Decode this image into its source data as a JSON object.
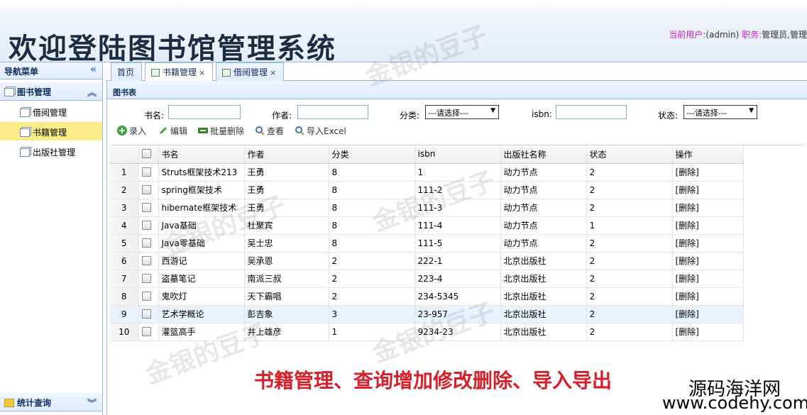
{
  "header": {
    "title": "欢迎登陆图书馆管理系统",
    "user_label": "当前用户:",
    "user_value": "(admin)",
    "role_label": "职务:",
    "role_value": "管理员,管理"
  },
  "nav": {
    "title": "导航菜单",
    "collapse_glyph": "«",
    "group1": {
      "label": "图书管理",
      "items": [
        "借阅管理",
        "书籍管理",
        "出版社管理"
      ]
    },
    "group2": {
      "label": "统计查询"
    }
  },
  "tabs": [
    {
      "label": "首页"
    },
    {
      "label": "书籍管理",
      "close": "×"
    },
    {
      "label": "借阅管理",
      "close": "×"
    }
  ],
  "panel": {
    "title": "图书表"
  },
  "search": {
    "bookname_label": "书名:",
    "author_label": "作者:",
    "category_label": "分类:",
    "category_value": "---请选择---",
    "isbn_label": "isbn:",
    "status_label": "状态:",
    "status_value": "---请选择---"
  },
  "toolbar": {
    "add": "录入",
    "edit": "编辑",
    "batch_delete": "批量删除",
    "view": "查看",
    "import": "导入Excel"
  },
  "table": {
    "columns": [
      "书名",
      "作者",
      "分类",
      "isbn",
      "出版社名称",
      "状态",
      "操作"
    ],
    "rows": [
      {
        "n": "1",
        "name": "Struts框架技术213",
        "author": "王勇",
        "cat": "8",
        "isbn": "1",
        "pub": "动力节点",
        "status": "2",
        "op": "[删除]"
      },
      {
        "n": "2",
        "name": "spring框架技术",
        "author": "王勇",
        "cat": "8",
        "isbn": "111-2",
        "pub": "动力节点",
        "status": "2",
        "op": "[删除]"
      },
      {
        "n": "3",
        "name": "hibernate框架技术",
        "author": "王勇",
        "cat": "8",
        "isbn": "111-3",
        "pub": "动力节点",
        "status": "2",
        "op": "[删除]"
      },
      {
        "n": "4",
        "name": "Java基础",
        "author": "杜聚宾",
        "cat": "8",
        "isbn": "111-4",
        "pub": "动力节点",
        "status": "1",
        "op": "[删除]"
      },
      {
        "n": "5",
        "name": "Java零基础",
        "author": "吴士忠",
        "cat": "8",
        "isbn": "111-5",
        "pub": "动力节点",
        "status": "2",
        "op": "[删除]"
      },
      {
        "n": "6",
        "name": "西游记",
        "author": "吴承恩",
        "cat": "2",
        "isbn": "222-1",
        "pub": "北京出版社",
        "status": "2",
        "op": "[删除]"
      },
      {
        "n": "7",
        "name": "盗墓笔记",
        "author": "南派三叔",
        "cat": "2",
        "isbn": "223-4",
        "pub": "北京出版社",
        "status": "2",
        "op": "[删除]"
      },
      {
        "n": "8",
        "name": "鬼吹灯",
        "author": "天下霸唱",
        "cat": "2",
        "isbn": "234-5345",
        "pub": "北京出版社",
        "status": "2",
        "op": "[删除]"
      },
      {
        "n": "9",
        "name": "艺术学概论",
        "author": "彭吉象",
        "cat": "3",
        "isbn": "23-957",
        "pub": "北京出版社",
        "status": "2",
        "op": "[删除]"
      },
      {
        "n": "10",
        "name": "灌篮高手",
        "author": "井上雄彦",
        "cat": "1",
        "isbn": "9234-23",
        "pub": "北京出版社",
        "status": "2",
        "op": "[删除]"
      }
    ]
  },
  "watermark": "金银的豆子",
  "overlay": {
    "promo": "书籍管理、查询增加修改删除、导入导出",
    "brand_cn": "源码海洋网",
    "brand_url": "www.codehy.com"
  },
  "colors": {
    "accent_border": "#95b8e7",
    "active_nav": "#fbec88",
    "promo_red": "#d81e2a"
  }
}
